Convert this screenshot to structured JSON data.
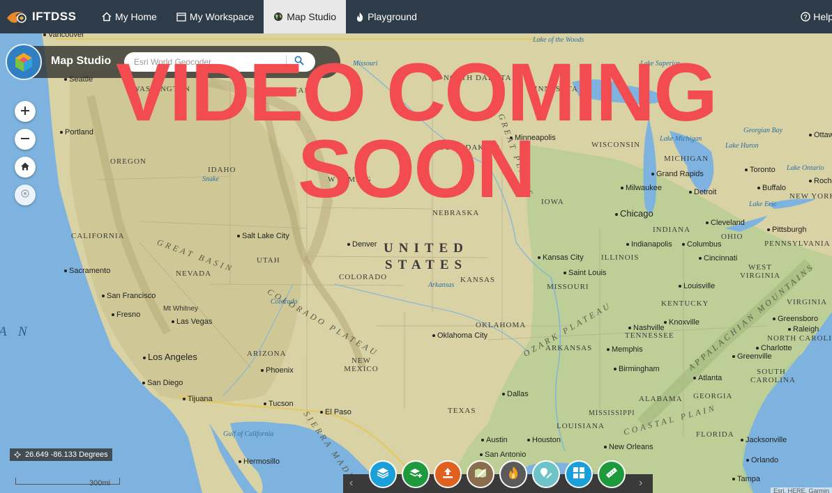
{
  "nav": {
    "brand": "IFTDSS",
    "items": [
      {
        "label": "My Home",
        "icon": "home-icon"
      },
      {
        "label": "My Workspace",
        "icon": "window-icon"
      },
      {
        "label": "Map Studio",
        "icon": "globe-icon",
        "active": true
      },
      {
        "label": "Playground",
        "icon": "fire-icon"
      }
    ],
    "help": "Help"
  },
  "studio": {
    "title": "Map Studio",
    "geocoder_placeholder": "Esri World Geocoder"
  },
  "controls": [
    "zoom-in",
    "zoom-out",
    "home",
    "locate"
  ],
  "coords": "26.649 -86.133 Degrees",
  "scale": "300mi",
  "overlay": {
    "line1": "VIDEO COMING",
    "line2": "SOON"
  },
  "toolbar": {
    "buttons": [
      {
        "name": "layers",
        "color": "#1a9fd8"
      },
      {
        "name": "add-layers",
        "color": "#1e9a3d"
      },
      {
        "name": "upload",
        "color": "#e0601f"
      },
      {
        "name": "edit-map",
        "color": "#8a6d4e"
      },
      {
        "name": "fire",
        "color": "#5a5a5a"
      },
      {
        "name": "draw",
        "color": "#6ec3c8"
      },
      {
        "name": "grid",
        "color": "#1a9fd8"
      },
      {
        "name": "measure",
        "color": "#1e9a3d"
      }
    ]
  },
  "map_labels": {
    "countries": [
      "UNITED",
      "STATES"
    ],
    "states": [
      "NORTH DAKOTA",
      "SOUTH DAKOTA",
      "MONTANA",
      "WASHINGTON",
      "OREGON",
      "IDAHO",
      "WYOMING",
      "NEBRASKA",
      "IOWA",
      "WISCONSIN",
      "MICHIGAN",
      "CALIFORNIA",
      "NEVADA",
      "UTAH",
      "COLORADO",
      "KANSAS",
      "MISSOURI",
      "ILLINOIS",
      "INDIANA",
      "OHIO",
      "KENTUCKY",
      "TENNESSEE",
      "ARIZONA",
      "NEW MEXICO",
      "OKLAHOMA",
      "ARKANSAS",
      "TEXAS",
      "LOUISIANA",
      "MISSISSIPPI",
      "ALABAMA",
      "GEORGIA",
      "FLORIDA",
      "SOUTH CAROLINA",
      "NORTH CAROLINA",
      "VIRGINIA",
      "WEST VIRGINIA",
      "PENNSYLVANIA",
      "NEW YORK",
      "MINNESOTA"
    ],
    "cities": [
      "Portland",
      "Seattle",
      "Vancouver",
      "Minneapolis",
      "Milwaukee",
      "Chicago",
      "Detroit",
      "Toronto",
      "Buffalo",
      "Grand Rapids",
      "Cleveland",
      "Pittsburgh",
      "Indianapolis",
      "Columbus",
      "Cincinnati",
      "Louisville",
      "Nashville",
      "Knoxville",
      "Memphis",
      "Birmingham",
      "Atlanta",
      "Greenville",
      "Charlotte",
      "Greensboro",
      "Raleigh",
      "Kansas City",
      "Saint Louis",
      "Denver",
      "Salt Lake City",
      "Sacramento",
      "San Francisco",
      "Fresno",
      "Las Vegas",
      "Los Angeles",
      "San Diego",
      "Tijuana",
      "Phoenix",
      "Tucson",
      "El Paso",
      "Oklahoma City",
      "Dallas",
      "Austin",
      "Houston",
      "San Antonio",
      "New Orleans",
      "Jacksonville",
      "Orlando",
      "Tampa",
      "Hermosillo",
      "Rochester",
      "Ottawa",
      "Mt Whitney"
    ],
    "water": [
      "Lake of the Woods",
      "Lake Superior",
      "Lake Michigan",
      "Lake Huron",
      "Georgian Bay",
      "Lake Ontario",
      "Lake Erie",
      "Missouri",
      "Arkansas",
      "Colorado",
      "Snake",
      "Gulf of California"
    ],
    "regions": [
      "GREAT BASIN",
      "COLORADO PLATEAU",
      "GREAT PLAINS",
      "OZARK PLATEAU",
      "APPALACHIAN MOUNTAINS",
      "COASTAL PLAIN",
      "SIERRA MADRE"
    ]
  }
}
